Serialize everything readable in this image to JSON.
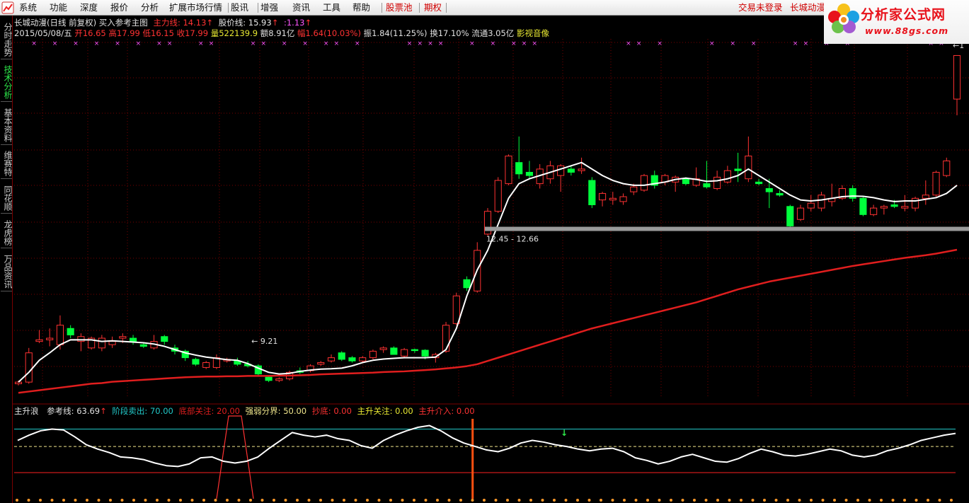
{
  "menu": {
    "items": [
      "系统",
      "功能",
      "深度",
      "报价",
      "分析",
      "扩展市场行情",
      "股讯",
      "增强",
      "资讯",
      "工具",
      "帮助"
    ],
    "stock_pool": "股票池",
    "options": "期权",
    "login_status": "交易未登录",
    "stock_name": "长城动漫"
  },
  "brand": {
    "title": "分析家公式网",
    "url": "www.88gs.com"
  },
  "left_tabs": [
    {
      "label": "分时走势",
      "active": false
    },
    {
      "label": "技术分析",
      "active": true
    },
    {
      "label": "基本资料",
      "active": false
    },
    {
      "label": "维赛特",
      "active": false
    },
    {
      "label": "同花顺",
      "active": false
    },
    {
      "label": "龙虎榜",
      "active": false
    },
    {
      "label": "万品资讯",
      "active": false
    }
  ],
  "main_header": {
    "title": "长城动漫(日线 前复权) 买入参考主图",
    "zhuli_label": "主力线:",
    "zhuli_value": "14.13",
    "gujia_label": "股价线:",
    "gujia_value": "15.93",
    "diff_value": ":1.13",
    "arrow": "↑"
  },
  "quote": {
    "date": "2015/05/08/五",
    "open_label": "开",
    "open": "16.65",
    "high_label": "高",
    "high": "17.99",
    "low_label": "低",
    "low": "16.15",
    "close_label": "收",
    "close": "17.99",
    "vol_label": "量",
    "vol": "522139.9",
    "amt_label": "额",
    "amt": "8.91亿",
    "pct_label": "幅",
    "pct": "1.64(10.03%)",
    "amp_label": "振",
    "amp": "1.84(11.25%)",
    "turnover_label": "换",
    "turnover": "17.10%",
    "float_label": "流通",
    "float": "3.05亿",
    "extra": "影视音像"
  },
  "annotations": {
    "low_label": "← 9.21",
    "range_label": "12.45 - 12.66",
    "high_label": "←1"
  },
  "indicator_header": {
    "name": "主升浪",
    "ref_label": "参考线:",
    "ref_value": "63.69",
    "ref_arrow": "↑",
    "sell_label": "阶段卖出:",
    "sell_value": "70.00",
    "bottom_label": "底部关注:",
    "bottom_value": "20.00",
    "div_label": "强弱分界:",
    "div_value": "50.00",
    "chaodi_label": "抄底:",
    "chaodi_value": "0.00",
    "attention_label": "主升关注:",
    "attention_value": "0.00",
    "entry_label": "主升介入:",
    "entry_value": "0.00"
  },
  "colors": {
    "up": "#ff3232",
    "down": "#00ff3c",
    "ma_white": "#ffffff",
    "ma_red": "#e01e1e",
    "sell_line": "#22c8c8",
    "mid_line": "#f0e68c",
    "bottom_line": "#e01e1e",
    "grid": "#7a0000",
    "marker": "#ff55ff"
  },
  "chart_data": [
    {
      "type": "candlestick",
      "title": "长城动漫(日线 前复权) 买入参考主图",
      "series_names": [
        "主力线",
        "股价线"
      ],
      "candles": [
        {
          "o": 7.9,
          "h": 8.0,
          "l": 7.85,
          "c": 7.95
        },
        {
          "o": 7.95,
          "h": 9.0,
          "l": 7.9,
          "c": 8.85
        },
        {
          "o": 9.2,
          "h": 9.55,
          "l": 9.15,
          "c": 9.25
        },
        {
          "o": 9.25,
          "h": 9.6,
          "l": 9.05,
          "c": 9.3
        },
        {
          "o": 9.1,
          "h": 10.0,
          "l": 8.95,
          "c": 9.7
        },
        {
          "o": 9.6,
          "h": 9.7,
          "l": 9.3,
          "c": 9.4
        },
        {
          "o": 9.2,
          "h": 9.45,
          "l": 8.9,
          "c": 9.35
        },
        {
          "o": 9.0,
          "h": 9.35,
          "l": 8.95,
          "c": 9.3
        },
        {
          "o": 9.0,
          "h": 9.4,
          "l": 8.9,
          "c": 9.3
        },
        {
          "o": 9.1,
          "h": 9.35,
          "l": 9.0,
          "c": 9.2
        },
        {
          "o": 9.3,
          "h": 9.45,
          "l": 9.15,
          "c": 9.35
        },
        {
          "o": 9.3,
          "h": 9.4,
          "l": 9.1,
          "c": 9.2
        },
        {
          "o": 9.1,
          "h": 9.15,
          "l": 9.0,
          "c": 9.05
        },
        {
          "o": 9.0,
          "h": 9.4,
          "l": 8.95,
          "c": 9.2
        },
        {
          "o": 9.35,
          "h": 9.4,
          "l": 9.1,
          "c": 9.2
        },
        {
          "o": 9.0,
          "h": 9.1,
          "l": 8.8,
          "c": 8.9
        },
        {
          "o": 8.9,
          "h": 8.95,
          "l": 8.6,
          "c": 8.7
        },
        {
          "o": 8.65,
          "h": 8.7,
          "l": 8.45,
          "c": 8.5
        },
        {
          "o": 8.4,
          "h": 8.6,
          "l": 8.35,
          "c": 8.55
        },
        {
          "o": 8.4,
          "h": 8.8,
          "l": 8.35,
          "c": 8.7
        },
        {
          "o": 8.6,
          "h": 8.7,
          "l": 8.55,
          "c": 8.65
        },
        {
          "o": 8.6,
          "h": 8.7,
          "l": 8.45,
          "c": 8.5
        },
        {
          "o": 8.5,
          "h": 8.6,
          "l": 8.4,
          "c": 8.45
        },
        {
          "o": 8.45,
          "h": 8.5,
          "l": 8.15,
          "c": 8.2
        },
        {
          "o": 8.1,
          "h": 8.15,
          "l": 7.95,
          "c": 8.0
        },
        {
          "o": 8.0,
          "h": 8.1,
          "l": 7.95,
          "c": 8.05
        },
        {
          "o": 8.05,
          "h": 8.3,
          "l": 8.0,
          "c": 8.25
        },
        {
          "o": 8.3,
          "h": 8.4,
          "l": 8.2,
          "c": 8.25
        },
        {
          "o": 8.3,
          "h": 8.5,
          "l": 8.25,
          "c": 8.45
        },
        {
          "o": 8.5,
          "h": 8.6,
          "l": 8.45,
          "c": 8.55
        },
        {
          "o": 8.6,
          "h": 8.8,
          "l": 8.55,
          "c": 8.7
        },
        {
          "o": 8.85,
          "h": 8.9,
          "l": 8.6,
          "c": 8.65
        },
        {
          "o": 8.7,
          "h": 8.75,
          "l": 8.55,
          "c": 8.6
        },
        {
          "o": 8.6,
          "h": 8.75,
          "l": 8.55,
          "c": 8.7
        },
        {
          "o": 8.7,
          "h": 8.95,
          "l": 8.65,
          "c": 8.9
        },
        {
          "o": 8.95,
          "h": 9.05,
          "l": 8.85,
          "c": 9.0
        },
        {
          "o": 9.0,
          "h": 9.05,
          "l": 8.8,
          "c": 8.8
        },
        {
          "o": 8.75,
          "h": 9.0,
          "l": 8.7,
          "c": 8.95
        },
        {
          "o": 8.95,
          "h": 8.98,
          "l": 8.85,
          "c": 8.93
        },
        {
          "o": 8.93,
          "h": 8.96,
          "l": 8.65,
          "c": 8.75
        },
        {
          "o": 8.7,
          "h": 8.85,
          "l": 8.55,
          "c": 8.8
        },
        {
          "o": 8.9,
          "h": 9.8,
          "l": 8.85,
          "c": 9.7
        },
        {
          "o": 9.75,
          "h": 10.7,
          "l": 9.7,
          "c": 10.6
        },
        {
          "o": 11.1,
          "h": 11.2,
          "l": 10.75,
          "c": 10.85
        },
        {
          "o": 10.75,
          "h": 12.25,
          "l": 10.7,
          "c": 12.0
        },
        {
          "o": 12.5,
          "h": 13.3,
          "l": 12.45,
          "c": 13.2
        },
        {
          "o": 13.2,
          "h": 14.25,
          "l": 13.15,
          "c": 14.15
        },
        {
          "o": 14.05,
          "h": 14.95,
          "l": 14.0,
          "c": 14.9
        },
        {
          "o": 14.7,
          "h": 15.5,
          "l": 14.2,
          "c": 14.35
        },
        {
          "o": 14.4,
          "h": 14.75,
          "l": 14.2,
          "c": 14.3
        },
        {
          "o": 14.05,
          "h": 14.65,
          "l": 13.9,
          "c": 14.5
        },
        {
          "o": 14.2,
          "h": 14.75,
          "l": 14.05,
          "c": 14.6
        },
        {
          "o": 14.3,
          "h": 14.65,
          "l": 13.8,
          "c": 14.6
        },
        {
          "o": 14.5,
          "h": 14.6,
          "l": 14.3,
          "c": 14.4
        },
        {
          "o": 14.45,
          "h": 14.85,
          "l": 14.35,
          "c": 14.5
        },
        {
          "o": 14.15,
          "h": 14.25,
          "l": 13.3,
          "c": 13.4
        },
        {
          "o": 13.55,
          "h": 13.8,
          "l": 13.35,
          "c": 13.75
        },
        {
          "o": 13.55,
          "h": 13.8,
          "l": 13.4,
          "c": 13.6
        },
        {
          "o": 13.5,
          "h": 13.75,
          "l": 13.4,
          "c": 13.65
        },
        {
          "o": 13.8,
          "h": 14.05,
          "l": 13.7,
          "c": 13.95
        },
        {
          "o": 13.85,
          "h": 14.35,
          "l": 13.8,
          "c": 14.3
        },
        {
          "o": 14.3,
          "h": 14.45,
          "l": 13.9,
          "c": 14.0
        },
        {
          "o": 14.1,
          "h": 14.35,
          "l": 14.0,
          "c": 14.3
        },
        {
          "o": 14.1,
          "h": 14.3,
          "l": 13.8,
          "c": 14.25
        },
        {
          "o": 14.2,
          "h": 14.25,
          "l": 14.0,
          "c": 14.05
        },
        {
          "o": 14.0,
          "h": 14.55,
          "l": 13.95,
          "c": 14.2
        },
        {
          "o": 14.05,
          "h": 14.75,
          "l": 13.9,
          "c": 13.95
        },
        {
          "o": 13.9,
          "h": 14.45,
          "l": 13.85,
          "c": 14.25
        },
        {
          "o": 14.1,
          "h": 14.6,
          "l": 14.05,
          "c": 14.45
        },
        {
          "o": 14.5,
          "h": 15.0,
          "l": 14.1,
          "c": 14.45
        },
        {
          "o": 14.2,
          "h": 15.5,
          "l": 14.1,
          "c": 14.9
        },
        {
          "o": 14.1,
          "h": 14.2,
          "l": 14.0,
          "c": 14.05
        },
        {
          "o": 13.9,
          "h": 14.2,
          "l": 13.3,
          "c": 13.8
        },
        {
          "o": 13.75,
          "h": 13.85,
          "l": 13.65,
          "c": 13.7
        },
        {
          "o": 13.35,
          "h": 13.4,
          "l": 12.6,
          "c": 12.75
        },
        {
          "o": 12.95,
          "h": 13.4,
          "l": 12.9,
          "c": 13.3
        },
        {
          "o": 13.3,
          "h": 13.7,
          "l": 13.2,
          "c": 13.45
        },
        {
          "o": 13.3,
          "h": 13.8,
          "l": 13.2,
          "c": 13.7
        },
        {
          "o": 13.5,
          "h": 14.05,
          "l": 13.35,
          "c": 13.6
        },
        {
          "o": 13.6,
          "h": 14.0,
          "l": 13.55,
          "c": 13.9
        },
        {
          "o": 13.9,
          "h": 14.0,
          "l": 13.5,
          "c": 13.6
        },
        {
          "o": 13.6,
          "h": 13.65,
          "l": 13.05,
          "c": 13.1
        },
        {
          "o": 13.1,
          "h": 13.4,
          "l": 13.05,
          "c": 13.3
        },
        {
          "o": 13.3,
          "h": 13.4,
          "l": 13.1,
          "c": 13.35
        },
        {
          "o": 13.4,
          "h": 13.55,
          "l": 13.3,
          "c": 13.35
        },
        {
          "o": 13.3,
          "h": 13.7,
          "l": 13.2,
          "c": 13.35
        },
        {
          "o": 13.3,
          "h": 13.65,
          "l": 13.2,
          "c": 13.6
        },
        {
          "o": 13.6,
          "h": 14.15,
          "l": 13.4,
          "c": 13.7
        },
        {
          "o": 13.7,
          "h": 14.45,
          "l": 13.65,
          "c": 14.4
        },
        {
          "o": 14.3,
          "h": 14.85,
          "l": 14.25,
          "c": 14.75
        },
        {
          "o": 16.65,
          "h": 17.99,
          "l": 16.15,
          "c": 17.99
        }
      ],
      "ma_white": [
        7.95,
        8.25,
        8.62,
        8.85,
        9.1,
        9.25,
        9.25,
        9.25,
        9.2,
        9.22,
        9.2,
        9.18,
        9.16,
        9.12,
        9.05,
        8.95,
        8.85,
        8.78,
        8.72,
        8.68,
        8.64,
        8.62,
        8.52,
        8.38,
        8.25,
        8.2,
        8.22,
        8.28,
        8.32,
        8.35,
        8.36,
        8.38,
        8.45,
        8.55,
        8.62,
        8.66,
        8.68,
        8.7,
        8.7,
        8.7,
        8.72,
        8.95,
        9.6,
        10.6,
        11.4,
        12.0,
        12.8,
        13.6,
        14.05,
        14.2,
        14.3,
        14.4,
        14.5,
        14.6,
        14.7,
        14.5,
        14.3,
        14.15,
        14.05,
        14.0,
        14.0,
        14.05,
        14.1,
        14.18,
        14.22,
        14.18,
        14.12,
        14.14,
        14.2,
        14.3,
        14.5,
        14.3,
        14.1,
        13.9,
        13.7,
        13.55,
        13.52,
        13.55,
        13.6,
        13.65,
        13.67,
        13.66,
        13.62,
        13.55,
        13.5,
        13.52,
        13.52,
        13.57,
        13.62,
        13.75,
        14.0
      ],
      "ma_red": [
        7.62,
        7.66,
        7.7,
        7.74,
        7.78,
        7.82,
        7.86,
        7.9,
        7.92,
        7.96,
        7.98,
        8.0,
        8.02,
        8.04,
        8.06,
        8.08,
        8.1,
        8.11,
        8.12,
        8.12,
        8.13,
        8.13,
        8.14,
        8.14,
        8.14,
        8.15,
        8.15,
        8.16,
        8.17,
        8.19,
        8.2,
        8.21,
        8.22,
        8.23,
        8.24,
        8.26,
        8.27,
        8.28,
        8.3,
        8.32,
        8.34,
        8.37,
        8.4,
        8.44,
        8.5,
        8.6,
        8.7,
        8.8,
        8.9,
        9.0,
        9.1,
        9.2,
        9.3,
        9.4,
        9.5,
        9.6,
        9.68,
        9.76,
        9.84,
        9.92,
        10.0,
        10.08,
        10.16,
        10.24,
        10.32,
        10.4,
        10.5,
        10.6,
        10.7,
        10.8,
        10.88,
        10.96,
        11.04,
        11.1,
        11.16,
        11.22,
        11.28,
        11.34,
        11.4,
        11.46,
        11.52,
        11.57,
        11.62,
        11.67,
        11.72,
        11.77,
        11.81,
        11.85,
        11.9,
        11.96,
        12.02
      ],
      "annotation_values": {
        "low": 9.21,
        "range": [
          12.45,
          12.66
        ]
      },
      "ylim": [
        7.3,
        18.5
      ]
    },
    {
      "type": "line",
      "title": "主升浪",
      "series_names": [
        "参考线",
        "阶段卖出",
        "底部关注",
        "强弱分界"
      ],
      "series": [
        {
          "name": "参考线",
          "values": [
            57,
            63,
            68,
            70,
            69,
            61,
            52,
            47,
            43,
            38,
            37,
            35,
            31,
            28,
            27,
            30,
            37,
            38,
            33,
            31,
            33,
            38,
            48,
            57,
            66,
            63,
            61,
            63,
            59,
            57,
            51,
            48,
            57,
            63,
            68,
            72,
            74,
            68,
            60,
            54,
            50,
            46,
            44,
            48,
            54,
            57,
            55,
            52,
            50,
            47,
            45,
            47,
            48,
            44,
            37,
            34,
            30,
            33,
            38,
            41,
            37,
            33,
            32,
            36,
            42,
            47,
            44,
            40,
            39,
            41,
            44,
            47,
            45,
            40,
            38,
            40,
            45,
            48,
            52,
            57,
            60,
            63,
            65
          ]
        },
        {
          "name": "阶段卖出",
          "value": 70
        },
        {
          "name": "底部关注",
          "value": 20
        },
        {
          "name": "强弱分界",
          "value": 50
        }
      ],
      "spike_positions": [
        0.2,
        0.487
      ],
      "ylim": [
        -10,
        85
      ]
    }
  ]
}
